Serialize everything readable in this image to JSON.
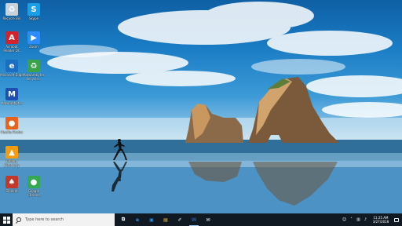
{
  "desktop": {
    "icons": [
      {
        "name": "recycle-bin-icon",
        "label": "Recycle Bin",
        "glyph": "♻",
        "color": "#c7d3dc"
      },
      {
        "name": "skype-icon",
        "label": "Skype",
        "glyph": "S",
        "color": "#1a9ee6"
      },
      {
        "name": "acrobat-reader-icon",
        "label": "Acrobat Reader DC",
        "glyph": "A",
        "color": "#d3222a"
      },
      {
        "name": "zoom-icon",
        "label": "Zoom",
        "glyph": "▶",
        "color": "#2d8cff"
      },
      {
        "name": "edge-icon",
        "label": "Microsoft Edge",
        "glyph": "e",
        "color": "#1b6ec2"
      },
      {
        "name": "malwarebytes-recycle-icon",
        "label": "Malwarebytes Recycle...",
        "glyph": "♻",
        "color": "#3aa34a"
      },
      {
        "name": "malwarebytes-icon",
        "label": "Malwarebytes",
        "glyph": "M",
        "color": "#1f4fb0"
      },
      {
        "name": "firefox-icon",
        "label": "Mozilla Firefox",
        "glyph": "●",
        "color": "#e8611f"
      },
      {
        "name": "gallery-icon",
        "label": "Gallery Discovery",
        "glyph": "▲",
        "color": "#f39c12"
      },
      {
        "name": "app-red-icon",
        "label": "ShieldX",
        "glyph": "♠",
        "color": "#c0392b"
      },
      {
        "name": "chrome-icon",
        "label": "Google Chrome",
        "glyph": "●",
        "color": "#34a853"
      }
    ]
  },
  "taskbar": {
    "search_placeholder": "Type here to search",
    "apps": [
      {
        "name": "task-view-icon",
        "glyph": "⧉",
        "color": "#ffffff",
        "active": false
      },
      {
        "name": "edge-taskbar-icon",
        "glyph": "e",
        "color": "#3b8eea",
        "active": false
      },
      {
        "name": "store-taskbar-icon",
        "glyph": "▣",
        "color": "#2f8ee0",
        "active": false
      },
      {
        "name": "photos-taskbar-icon",
        "glyph": "▤",
        "color": "#f2c14e",
        "active": false
      },
      {
        "name": "paint-taskbar-icon",
        "glyph": "✐",
        "color": "#e0e0e0",
        "active": false
      },
      {
        "name": "word-taskbar-icon",
        "glyph": "W",
        "color": "#2b579a",
        "active": true
      },
      {
        "name": "mail-taskbar-icon",
        "glyph": "✉",
        "color": "#ffffff",
        "active": false
      }
    ],
    "tray": {
      "icons": [
        {
          "name": "people-icon",
          "glyph": "☺"
        },
        {
          "name": "chevron-up-icon",
          "glyph": "˄"
        },
        {
          "name": "network-icon",
          "glyph": "▥"
        },
        {
          "name": "volume-icon",
          "glyph": "♪"
        }
      ],
      "time": "11:25 AM",
      "date": "3/27/2018"
    }
  }
}
